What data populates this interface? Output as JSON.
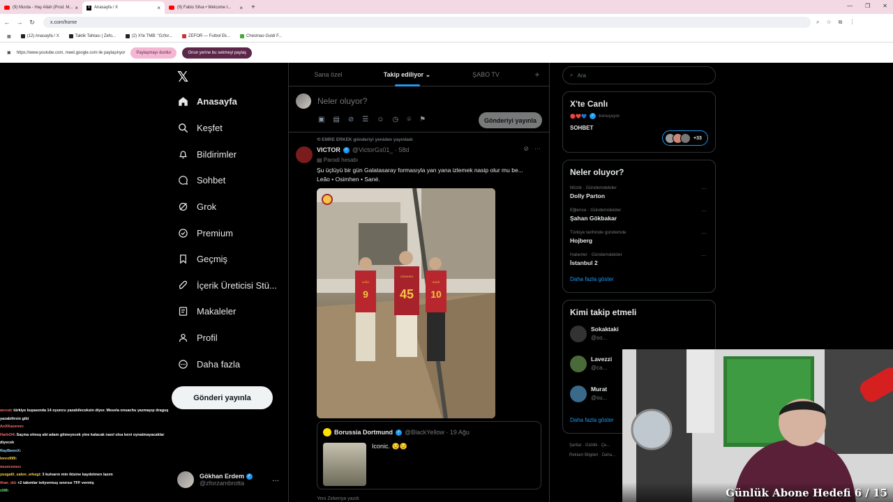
{
  "browser": {
    "tabs": [
      {
        "title": "(9) Murda - Hay Allah (Prod. M...",
        "icon": "youtube"
      },
      {
        "title": "Anasayfa / X",
        "icon": "x"
      },
      {
        "title": "(9) Fabio Silva • Welcome t...",
        "icon": "youtube"
      }
    ],
    "url": "x.com/home",
    "bookmarks": [
      "(12) Anasayfa / X",
      "Taktik Tahtası | Zefo...",
      "(2) X'te TMB: \"Gzfor...",
      "ZEFOR — Futbol Ek...",
      "Chestnao Guldi F..."
    ],
    "share": {
      "text": "https://www.youtube.com, meet.google.com ile paylaşılıyor",
      "stop": "Paylaşmayı durdur",
      "switch": "Onun yerine bu sekmeyi paylaş"
    }
  },
  "nav": {
    "items": [
      {
        "label": "Anasayfa",
        "icon": "home-icon"
      },
      {
        "label": "Keşfet",
        "icon": "search-icon"
      },
      {
        "label": "Bildirimler",
        "icon": "bell-icon"
      },
      {
        "label": "Sohbet",
        "icon": "chat-icon"
      },
      {
        "label": "Grok",
        "icon": "grok-icon"
      },
      {
        "label": "Premium",
        "icon": "premium-icon"
      },
      {
        "label": "Geçmiş",
        "icon": "bookmark-icon"
      },
      {
        "label": "İçerik Üreticisi Stü...",
        "icon": "rocket-icon"
      },
      {
        "label": "Makaleler",
        "icon": "article-icon"
      },
      {
        "label": "Profil",
        "icon": "person-icon"
      },
      {
        "label": "Daha fazla",
        "icon": "more-icon"
      }
    ],
    "post_button": "Gönderi yayınla",
    "profile": {
      "name": "Gökhan Erdem",
      "handle": "@zforzambrotta"
    }
  },
  "chat": [
    {
      "user": "anıcat",
      "msg": ": türkiye kupasında 14 oyuncu yazabileceksin diyor. Mesela onuachu yazmayıp draguş yazabilirsin gibi"
    },
    {
      "user": "AxXKaxemn",
      "msg": ":"
    },
    {
      "user": "Harbi34",
      "msg": ": Saçma olmuş abi adam gitmeyecek yine kalacak nasıl olsa beni oynatmayacaklar diyecek"
    },
    {
      "user": "RayBwenX",
      "msg": ":"
    },
    {
      "user": "lorex999",
      "msg": ":"
    },
    {
      "user": "musicenes",
      "msg": ":"
    },
    {
      "user": "yozgatli_salon_erkegi",
      "msg": ": 3 kulvarın min ikisine kaydetmen lazım"
    },
    {
      "user": "ifran_dd",
      "msg": ": +2 takımlar istiyormuş sınırsız TFF vermiş"
    },
    {
      "user": "clilll",
      "msg": ":"
    }
  ],
  "timeline": {
    "tabs": [
      "Sana özel",
      "Takip ediliyor",
      "ŞABO TV"
    ],
    "active_tab": 1,
    "compose_placeholder": "Neler oluyor?",
    "compose_button": "Gönderiyi yayınla",
    "tweet": {
      "repost_line": "EMRE ERKEK gönderiyi yeniden yayınladı",
      "name": "VICTOR",
      "handle": "@VictorGs01_ · 58d",
      "badge": "Parodi hesabı",
      "text": "Şu üçlüyü bir gün Galatasaray formasıyla yan yana izlemek nasip olur mu be... Leão • Osimhen • Sané.",
      "jerseys": [
        "9",
        "45",
        "10"
      ],
      "jersey_names": [
        "LEÃO",
        "OSIMHEN",
        "SANÉ"
      ],
      "quote": {
        "name": "Borussia Dortmund",
        "handle": "@BlackYellow · 19 Ağu",
        "text": "Iconic. 😒😒"
      }
    },
    "below_text": "Yeni Zekeriya yazdı"
  },
  "right": {
    "search_placeholder": "Ara",
    "live": {
      "title": "X'te Canlı",
      "speaker": "konuşuyor",
      "topic": "SOHBET",
      "count": "+33"
    },
    "trends_title": "Neler oluyor?",
    "trends": [
      {
        "category": "Müzik · Gündemdekiler",
        "name": "Dolly Parton"
      },
      {
        "category": "Eğlence · Gündemdekiler",
        "name": "Şahan Gökbakar"
      },
      {
        "category": "Türkiye tarihinde gündemde",
        "name": "Hojberg"
      },
      {
        "category": "Haberler · Gündemdekiler",
        "name": "İstanbul 2"
      }
    ],
    "show_more": "Daha fazla göster",
    "follow_title": "Kimi takip etmeli",
    "follow": [
      {
        "name": "Sokaktaki",
        "handle": "@so..."
      },
      {
        "name": "Lavezzi",
        "handle": "@ca..."
      },
      {
        "name": "Murat",
        "handle": "@su..."
      }
    ],
    "follow_more": "Daha fazla göster",
    "footer": [
      "Şartlar",
      "Gizlilik",
      "Çe...",
      "Reklam Bilgileri",
      "Daha..."
    ]
  },
  "overlay": {
    "goal": "Günlük Abone Hedefi 6 / 15"
  }
}
